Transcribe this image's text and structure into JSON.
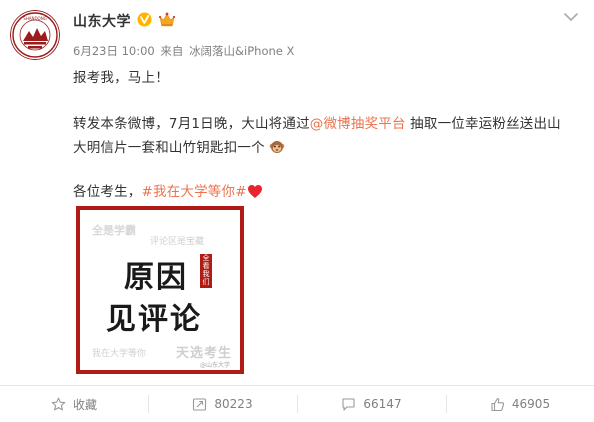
{
  "user": {
    "name": "山东大学",
    "avatar_icon": "university-seal-icon",
    "verified_icon": "verified-v-icon",
    "vip_icon": "crown-vip-icon"
  },
  "meta": {
    "date": "6月23日 10:00",
    "source_prefix": "来自",
    "source": "冰阔落山&iPhone X"
  },
  "post": {
    "line1": "报考我，马上！",
    "line2_prefix": "转发本条微博，7月1日晚，大山将通过",
    "line2_link": "@微博抽奖平台",
    "line2_suffix": " 抽取一位幸运粉丝送出山",
    "line3": "大明信片一套和山竹钥匙扣一个",
    "line3_emoji": "monkey-emoji-icon",
    "line4_prefix": "各位考生，",
    "line4_topic": "#我在大学等你#",
    "line4_emoji": "red-heart-icon"
  },
  "image": {
    "top_left": "全是学霸",
    "top_right": "评论区是宝藏",
    "main1": "原因",
    "main2": "见评论",
    "seal": "全看我们",
    "bottom_left": "我在大学等你",
    "bottom_right": "天选考生",
    "image_watermark": "@山东大学"
  },
  "actions": {
    "favorite": "收藏",
    "repost": "80223",
    "comment": "66147",
    "like": "46905"
  },
  "colors": {
    "link": "#eb7350",
    "brand_red": "#b01c15",
    "verified": "#ffb400",
    "muted": "#808080"
  }
}
